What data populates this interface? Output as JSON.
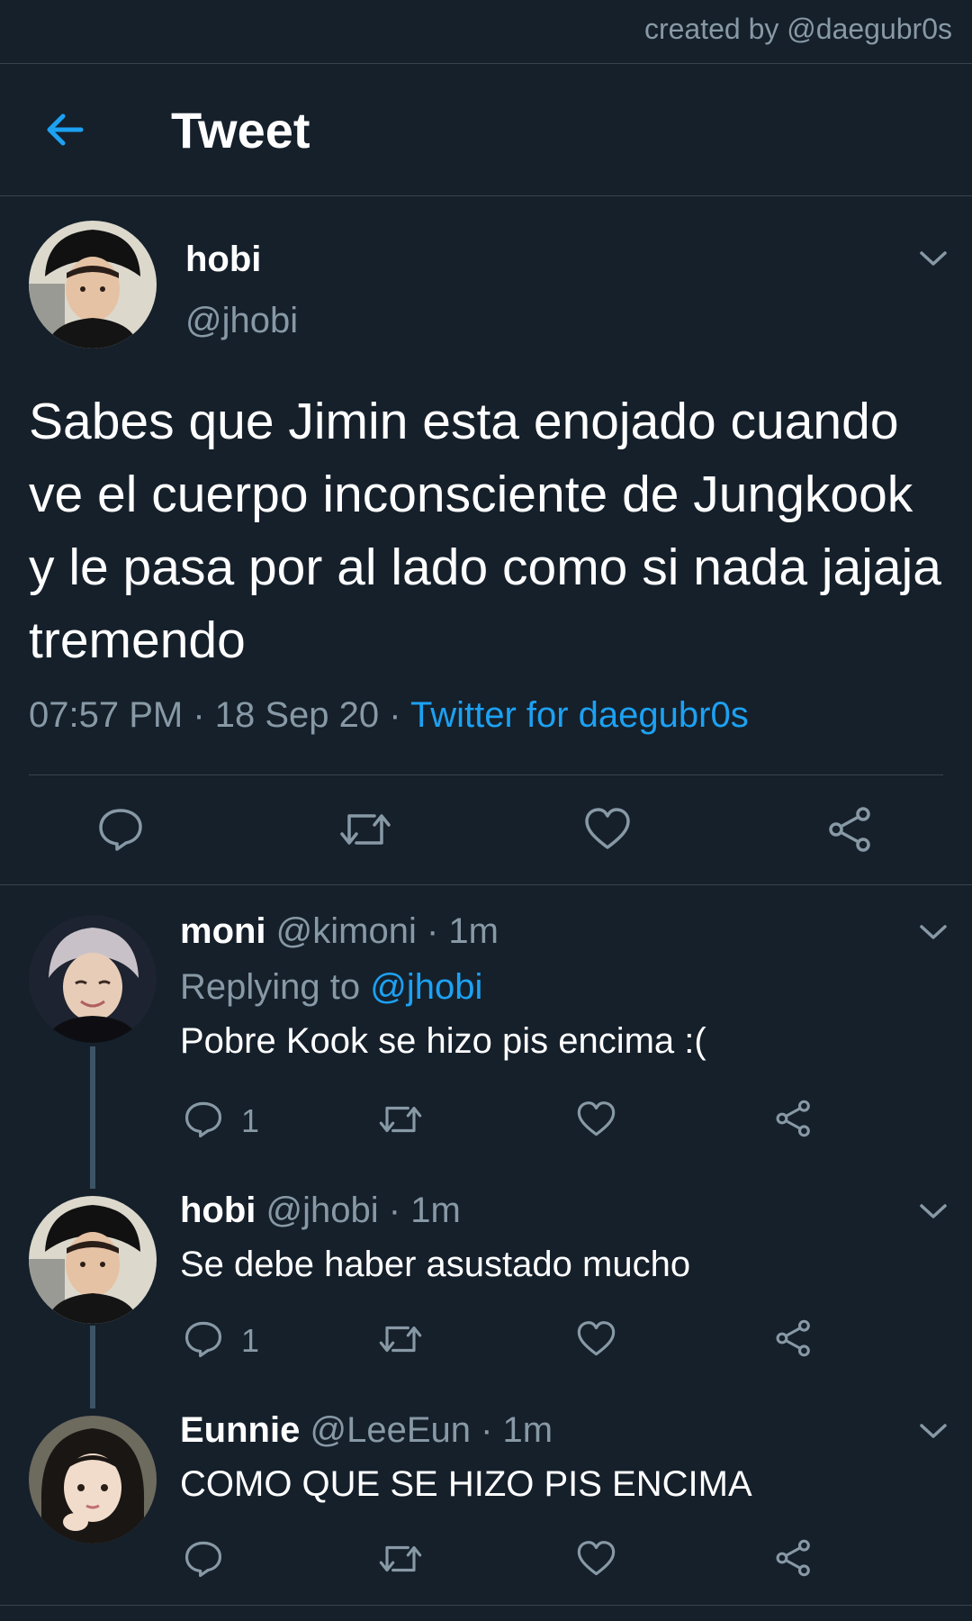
{
  "credit": "created by @daegubr0s",
  "header": {
    "title": "Tweet",
    "back_icon": "arrow-left-icon"
  },
  "colors": {
    "background": "#15202b",
    "accent": "#1da1f2",
    "muted": "#8899a6",
    "divider": "#38444d"
  },
  "main_tweet": {
    "name": "hobi",
    "handle": "@jhobi",
    "text": "Sabes que Jimin esta enojado cuando ve el cuerpo inconsciente de Jungkook y le pasa por al lado como si nada jajaja tremendo",
    "time": "07:57 PM",
    "date": "18 Sep 20",
    "source": "Twitter for daegubr0s",
    "separator": " · ",
    "actions": [
      "reply-icon",
      "retweet-icon",
      "like-icon",
      "share-icon"
    ]
  },
  "replies": [
    {
      "name": "moni",
      "handle": "@kimoni",
      "time": "· 1m",
      "replying_prefix": "Replying to ",
      "replying_to": "@jhobi",
      "text": "Pobre Kook se hizo pis encima :(",
      "reply_count": "1"
    },
    {
      "name": "hobi",
      "handle": "@jhobi",
      "time": "· 1m",
      "text": "Se debe haber asustado mucho",
      "reply_count": "1"
    },
    {
      "name": "Eunnie",
      "handle": "@LeeEun",
      "time": "· 1m",
      "text": "COMO QUE SE HIZO PIS ENCIMA"
    }
  ]
}
